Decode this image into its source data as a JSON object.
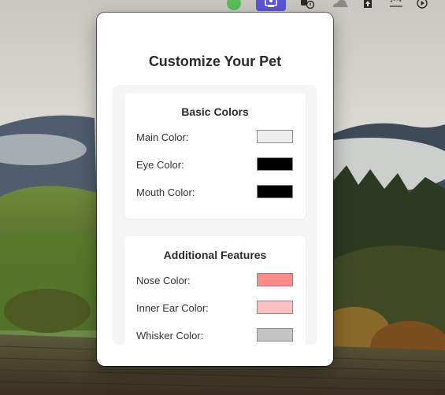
{
  "popover": {
    "title": "Customize Your Pet",
    "sections": [
      {
        "title": "Basic Colors",
        "rows": [
          {
            "label": "Main Color:",
            "color": "#eeeeee"
          },
          {
            "label": "Eye Color:",
            "color": "#000000"
          },
          {
            "label": "Mouth Color:",
            "color": "#000000"
          }
        ]
      },
      {
        "title": "Additional Features",
        "rows": [
          {
            "label": "Nose Color:",
            "color": "#ff8a8a"
          },
          {
            "label": "Inner Ear Color:",
            "color": "#ffc0c0"
          },
          {
            "label": "Whisker Color:",
            "color": "#c4c4c4"
          }
        ]
      }
    ]
  },
  "menubar": {
    "icons": [
      "status-green-dot-icon",
      "pet-app-icon",
      "activity-monitor-icon",
      "cloud-icon",
      "file-upload-icon",
      "wifi-dots-icon",
      "play-icon"
    ],
    "accent_color": "#5b56d6"
  }
}
